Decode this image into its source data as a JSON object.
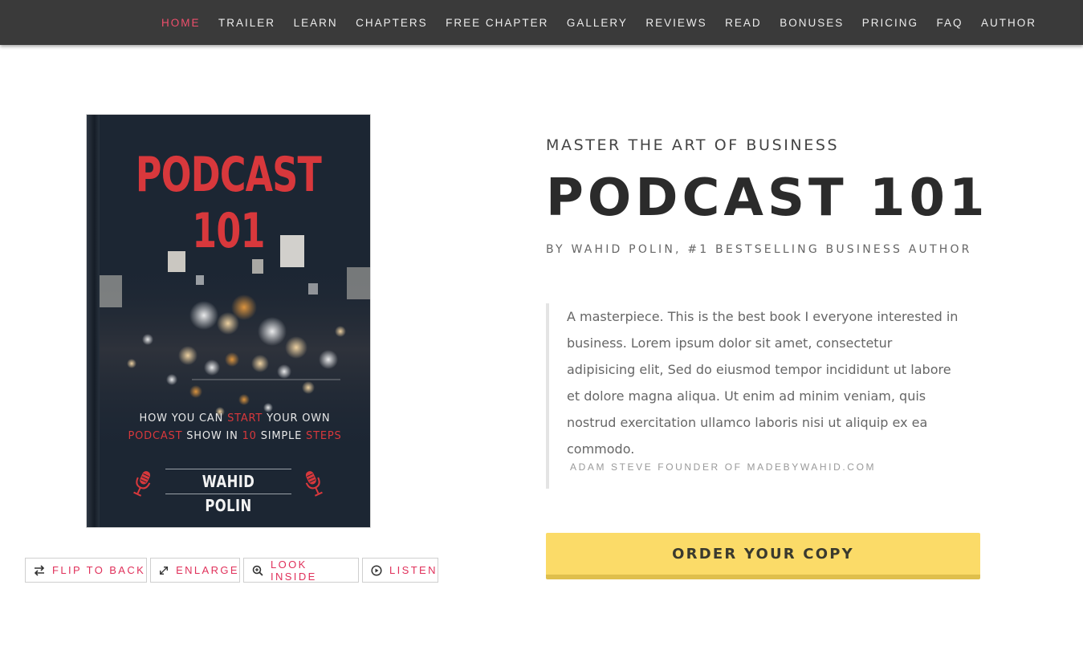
{
  "nav": {
    "items": [
      {
        "label": "HOME",
        "active": true
      },
      {
        "label": "TRAILER"
      },
      {
        "label": "LEARN"
      },
      {
        "label": "CHAPTERS"
      },
      {
        "label": "FREE CHAPTER"
      },
      {
        "label": "GALLERY"
      },
      {
        "label": "REVIEWS"
      },
      {
        "label": "READ"
      },
      {
        "label": "BONUSES"
      },
      {
        "label": "PRICING"
      },
      {
        "label": "FAQ"
      },
      {
        "label": "AUTHOR"
      }
    ]
  },
  "book": {
    "cover_title": "PODCAST 101",
    "tagline_line1": {
      "a": "HOW YOU CAN ",
      "b": "START",
      "c": " YOUR OWN"
    },
    "tagline_line2": {
      "a": "PODCAST",
      "b": " SHOW IN ",
      "c": "10",
      "d": " SIMPLE ",
      "e": "STEPS"
    },
    "cover_author": "WAHID POLIN",
    "mic_icon": "microphone-icon"
  },
  "book_buttons": {
    "flip": {
      "label": "FLIP TO BACK",
      "icon": "swap-icon"
    },
    "enlarge": {
      "label": "ENLARGE",
      "icon": "expand-icon"
    },
    "look_inside": {
      "label": "LOOK INSIDE",
      "icon": "zoom-icon"
    },
    "listen": {
      "label": "LISTEN",
      "icon": "play-circle-icon"
    }
  },
  "hero": {
    "eyebrow": "MASTER THE ART OF BUSINESS",
    "title": "PODCAST 101",
    "byline": "BY WAHID POLIN, #1 BESTSELLING BUSINESS AUTHOR"
  },
  "testimonial": {
    "text": "A masterpiece. This is the best book I everyone interested in business. Lorem ipsum dolor sit amet, consectetur adipisicing elit, Sed do eiusmod tempor incididunt ut labore et dolore magna aliqua. Ut enim ad minim veniam, quis nostrud exercitation ullamco laboris nisi ut aliquip ex ea commodo.",
    "cite": "ADAM STEVE FOUNDER OF MADEBYWAHID.COM"
  },
  "cta": {
    "label": "ORDER YOUR COPY"
  },
  "colors": {
    "accent": "#ef4f6c",
    "cover_red": "#d8383c",
    "cta_yellow": "#fbdb68",
    "nav_bg": "#3a3a3a"
  }
}
